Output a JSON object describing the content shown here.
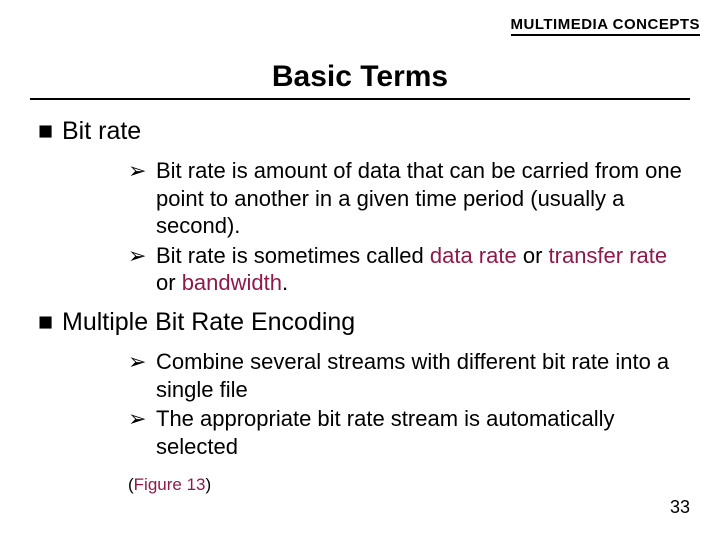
{
  "header": {
    "label": "MULTIMEDIA CONCEPTS"
  },
  "title": "Basic Terms",
  "topics": [
    {
      "heading": "Bit rate",
      "points": [
        {
          "plain": "Bit rate is amount of data that can be carried from one point to another in a given time period (usually a second)."
        },
        {
          "pre": "Bit rate is sometimes called ",
          "hl1": "data rate",
          "mid1": " or ",
          "hl2": "transfer rate",
          "mid2": " or ",
          "hl3": "bandwidth",
          "post": "."
        }
      ]
    },
    {
      "heading": "Multiple Bit Rate Encoding",
      "points": [
        {
          "plain": "Combine several streams with different bit rate into a single file"
        },
        {
          "plain": "The appropriate bit rate stream is automatically selected"
        }
      ],
      "figure": {
        "open": "(",
        "label": "Figure 13",
        "close": ")"
      }
    }
  ],
  "glyphs": {
    "square": "■",
    "arrow": "➢"
  },
  "page_number": "33"
}
